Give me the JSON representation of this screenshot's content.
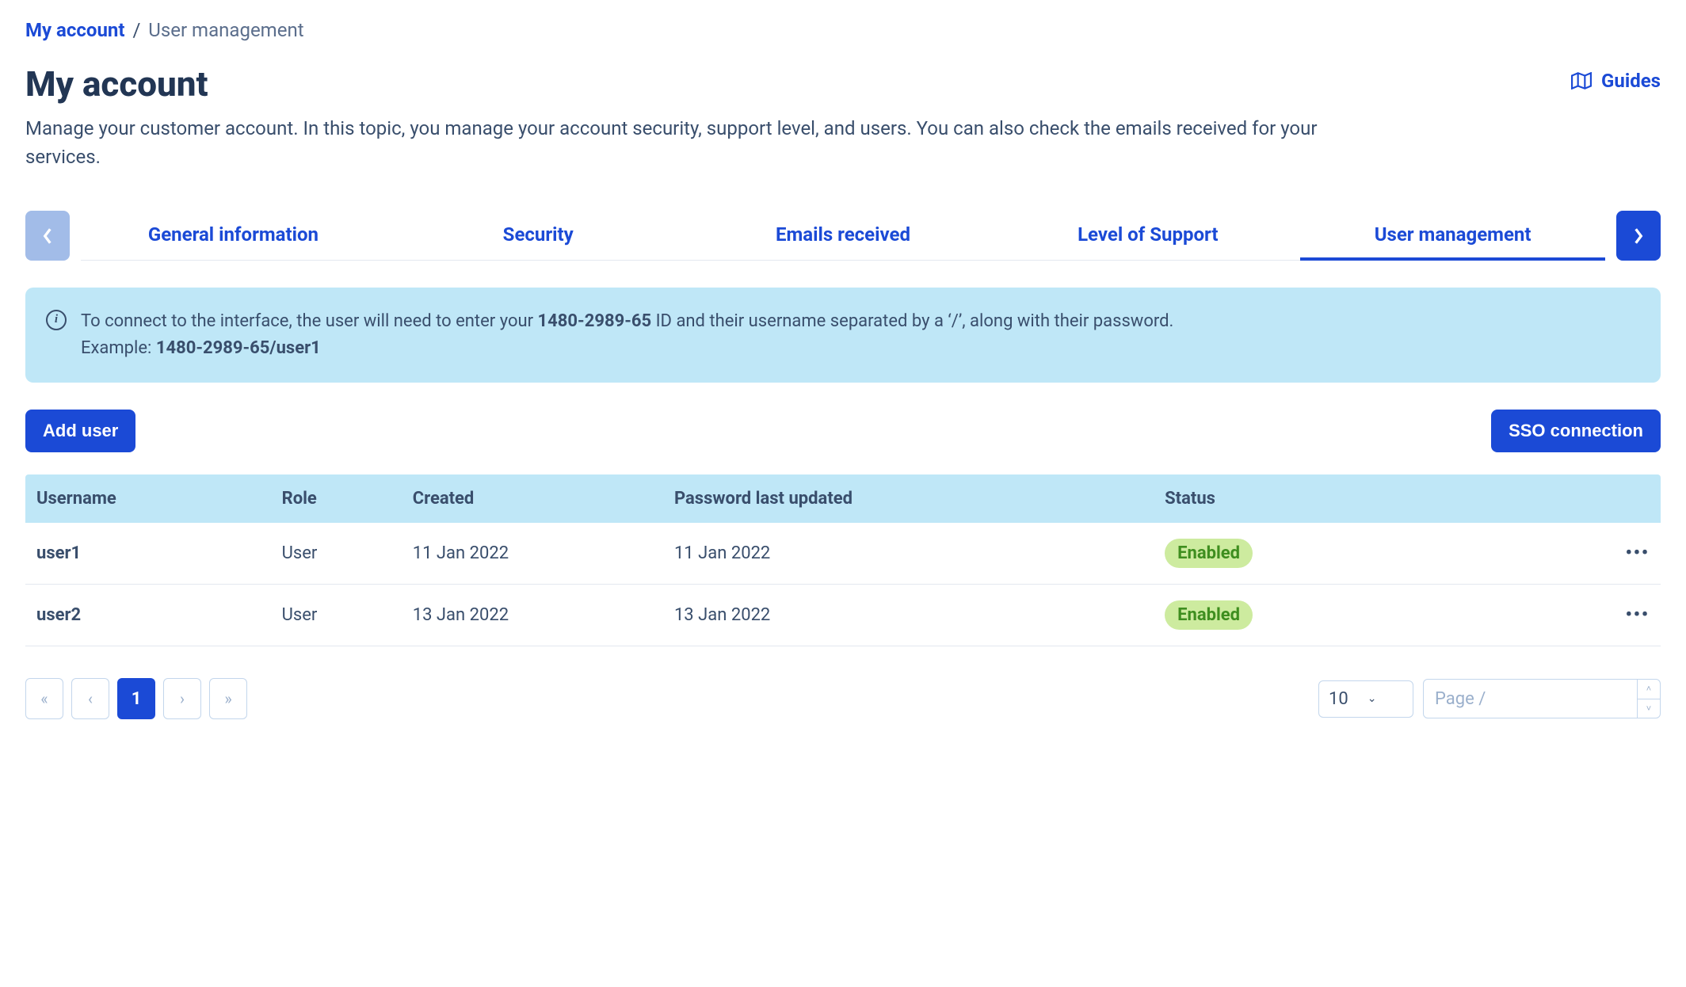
{
  "breadcrumb": {
    "root": "My account",
    "current": "User management"
  },
  "header": {
    "title": "My account",
    "guides_label": "Guides",
    "description": "Manage your customer account. In this topic, you manage your account security, support level, and users. You can also check the emails received for your services."
  },
  "tabs": [
    {
      "label": "General information",
      "active": false
    },
    {
      "label": "Security",
      "active": false
    },
    {
      "label": "Emails received",
      "active": false
    },
    {
      "label": "Level of Support",
      "active": false
    },
    {
      "label": "User management",
      "active": true
    }
  ],
  "info_banner": {
    "text_prefix": "To connect to the interface, the user will need to enter your ",
    "account_id": "1480-2989-65",
    "text_middle": " ID and their username separated by a ‘/’, along with their password.",
    "example_label": "Example: ",
    "example_value": "1480-2989-65/user1"
  },
  "actions": {
    "add_user": "Add user",
    "sso_connection": "SSO connection"
  },
  "table": {
    "columns": {
      "username": "Username",
      "role": "Role",
      "created": "Created",
      "password_last_updated": "Password last updated",
      "status": "Status"
    },
    "rows": [
      {
        "username": "user1",
        "role": "User",
        "created": "11 Jan 2022",
        "password_last_updated": "11 Jan 2022",
        "status": "Enabled"
      },
      {
        "username": "user2",
        "role": "User",
        "created": "13 Jan 2022",
        "password_last_updated": "13 Jan 2022",
        "status": "Enabled"
      }
    ]
  },
  "pagination": {
    "current_page": "1",
    "page_size": "10",
    "page_input_label": "Page  /"
  }
}
